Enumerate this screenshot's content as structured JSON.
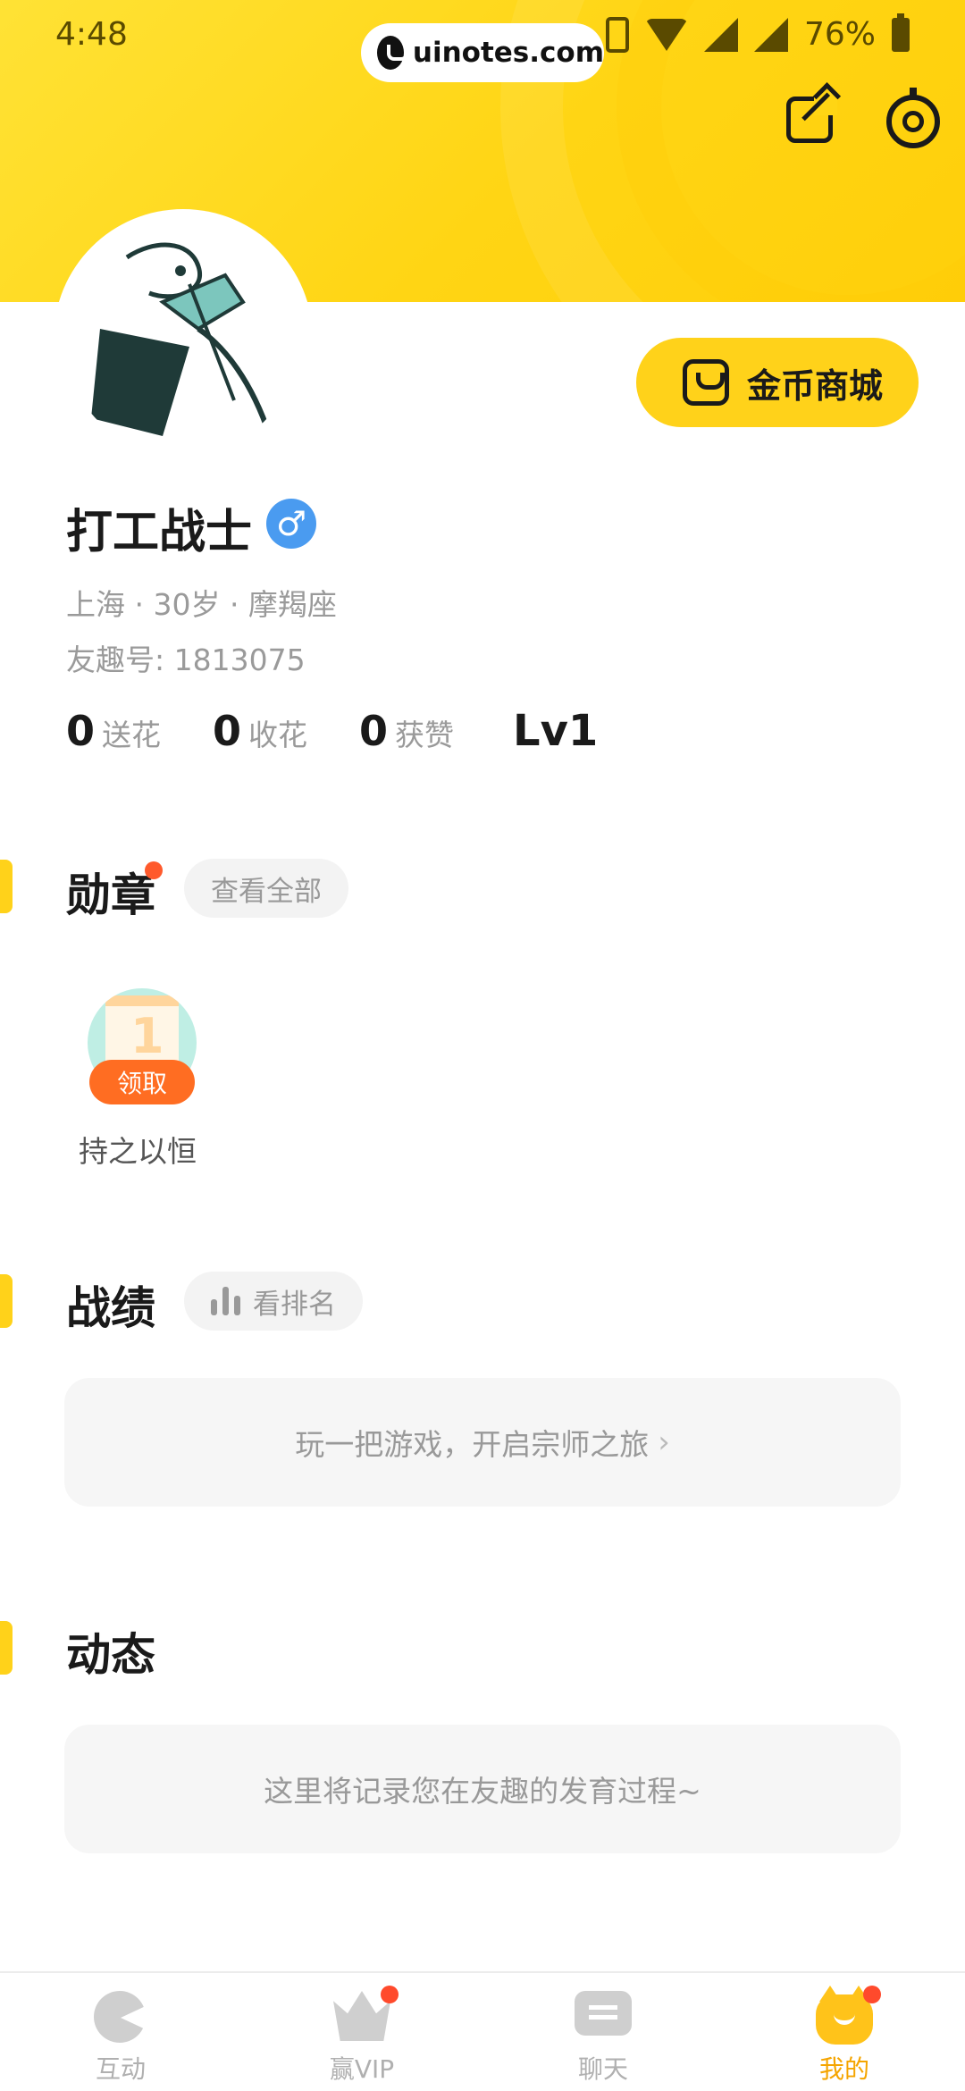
{
  "status_bar": {
    "time": "4:48",
    "url": "uinotes.com",
    "battery": "76%"
  },
  "header": {
    "share_icon": "share-icon",
    "settings_icon": "settings-icon",
    "coin_mall_label": "金币商城"
  },
  "profile": {
    "username": "打工战士",
    "gender_symbol": "♂",
    "location_age_sign": "上海 · 30岁 · 摩羯座",
    "user_id": "友趣号: 1813075",
    "stats": [
      {
        "num": "0",
        "label": "送花"
      },
      {
        "num": "0",
        "label": "收花"
      },
      {
        "num": "0",
        "label": "获赞"
      }
    ],
    "level": "Lv1"
  },
  "medals": {
    "title": "勋章",
    "view_all": "查看全部",
    "items": [
      {
        "name": "持之以恒",
        "claim_label": "领取",
        "numeral": "1"
      }
    ]
  },
  "record": {
    "title": "战绩",
    "rank_label": "看排名",
    "empty_text": "玩一把游戏，开启宗师之旅",
    "chevron": "›"
  },
  "feed": {
    "title": "动态",
    "empty_text": "这里将记录您在友趣的发育过程~"
  },
  "bottom_nav": {
    "items": [
      {
        "label": "互动",
        "icon": "pacman-icon",
        "badge": false
      },
      {
        "label": "赢VIP",
        "icon": "crown-icon",
        "badge": true
      },
      {
        "label": "聊天",
        "icon": "chat-icon",
        "badge": false
      },
      {
        "label": "我的",
        "icon": "cat-icon",
        "badge": true,
        "active": true
      }
    ]
  },
  "colors": {
    "brand_yellow": "#ffd514",
    "accent_orange": "#ff6d22",
    "active_tab": "#f5a500",
    "gender_blue": "#4a9bf0"
  }
}
